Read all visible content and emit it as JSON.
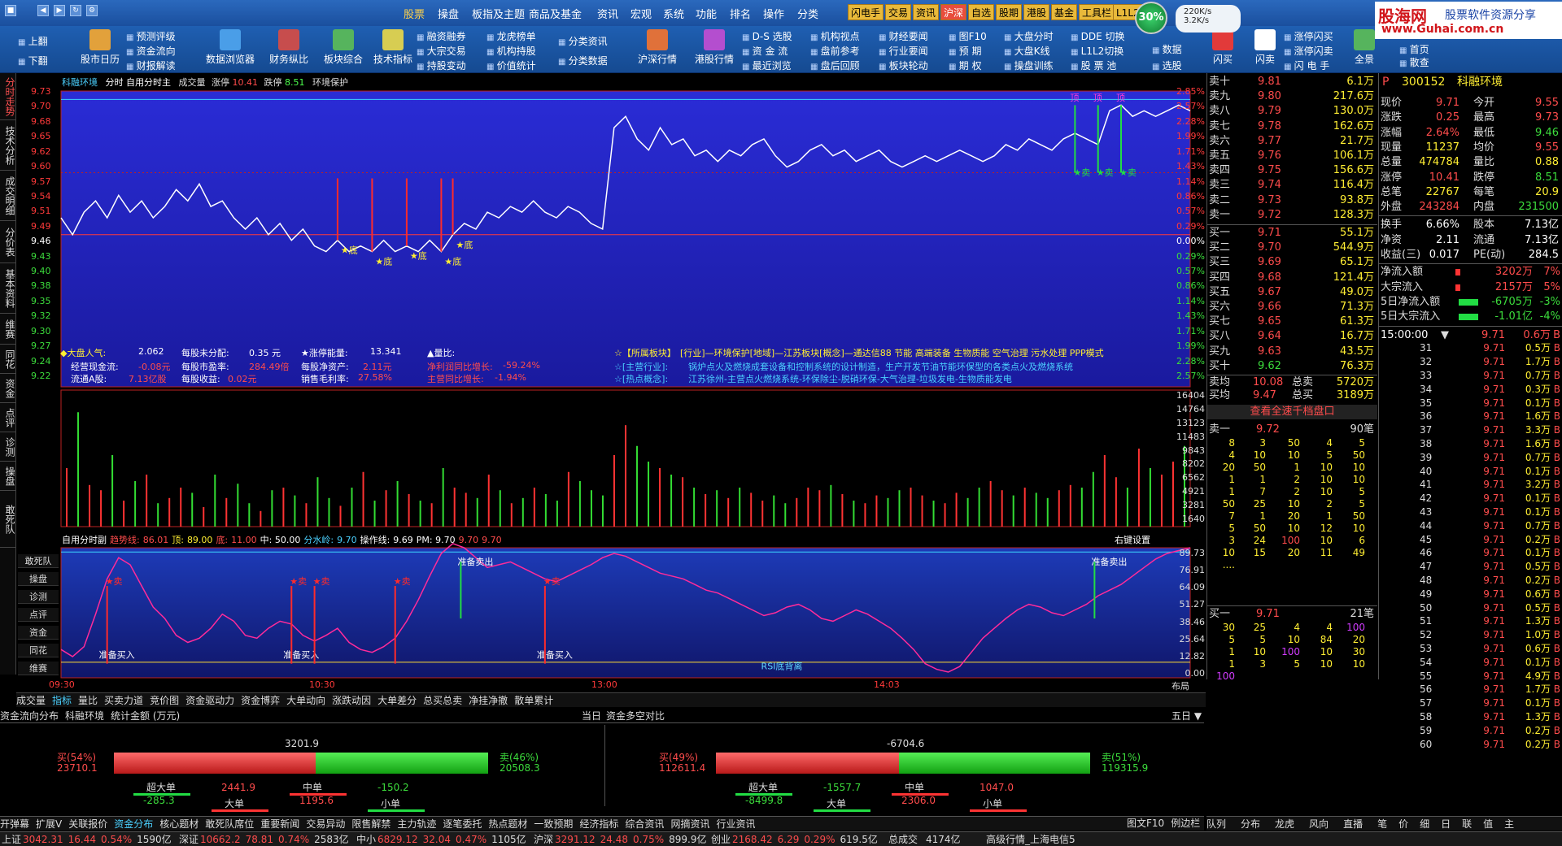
{
  "titlebar": {
    "menu": [
      "股票",
      "操盘",
      "板指及主题",
      "商品及基金",
      "资讯",
      "宏观",
      "系统",
      "功能",
      "排名",
      "操作",
      "分类"
    ],
    "hot": [
      "闪电手",
      "交易",
      "资讯",
      "沪深",
      "自选",
      "股期",
      "港股",
      "基金",
      "工具栏",
      "L1L2"
    ],
    "cpu": "30%",
    "net_up": "220K/s",
    "net_down": "3.2K/s",
    "brand": "股海网",
    "brand_sub": "股票软件资源分享",
    "brand_url": "www.Guhai.com.cn"
  },
  "toolbar": {
    "left_btns": [
      "上翻",
      "下翻"
    ],
    "big_btns": [
      "股市日历",
      "数据浏览器",
      "财务纵比",
      "板块综合",
      "技术指标",
      "沪深行情",
      "港股行情"
    ],
    "small_btns": [
      "预测评级",
      "资金流向",
      "财报解读",
      "融资融券",
      "大宗交易",
      "持股变动",
      "龙虎榜单",
      "机构持股",
      "价值统计",
      "分类资讯",
      "分类数据",
      "D-S 选股",
      "资 金 流",
      "最近浏览",
      "机构视点",
      "盘前参考",
      "盘后回顾",
      "财经要闻",
      "行业要闻",
      "板块轮动",
      "图F10",
      "预 期",
      "期 权",
      "大盘分时",
      "大盘K线",
      "操盘训练",
      "DDE 切换",
      "L1L2切换",
      "股 票 池",
      "数据",
      "选股",
      "涨停闪买",
      "涨停闪卖",
      "闪 电 手"
    ],
    "right_btns": [
      "闪买",
      "闪卖",
      "全景",
      "首页",
      "散查"
    ]
  },
  "lefttabs": [
    "分时走势",
    "技术分析",
    "成交明细",
    "分价表",
    "基本资料",
    "维赛",
    "同花",
    "资金",
    "点评",
    "诊测",
    "操盘",
    "敢死队"
  ],
  "chart": {
    "header": {
      "name": "科融环境",
      "mode": "分时 自用分时主",
      "vol": "成交量",
      "zt_label": "涨停",
      "zt": "10.41",
      "dt_label": "跌停",
      "dt": "8.51",
      "tag": "环境保护"
    },
    "price_axis_left": [
      "9.73",
      "9.70",
      "9.68",
      "9.65",
      "9.62",
      "9.60",
      "9.57",
      "9.54",
      "9.51",
      "9.49",
      "9.46",
      "9.43",
      "9.40",
      "9.38",
      "9.35",
      "9.32",
      "9.30",
      "9.27",
      "9.24",
      "9.22"
    ],
    "price_axis_right": [
      "2.85%",
      "2.57%",
      "2.28%",
      "1.99%",
      "1.71%",
      "1.43%",
      "1.14%",
      "0.86%",
      "0.57%",
      "0.29%",
      "0.00%",
      "0.29%",
      "0.57%",
      "0.86%",
      "1.14%",
      "1.43%",
      "1.71%",
      "1.99%",
      "2.28%",
      "2.57%"
    ],
    "price_line": [
      9.52,
      9.49,
      9.53,
      9.55,
      9.52,
      9.56,
      9.53,
      9.55,
      9.52,
      9.54,
      9.57,
      9.55,
      9.58,
      9.54,
      9.55,
      9.52,
      9.5,
      9.52,
      9.49,
      9.51,
      9.48,
      9.5,
      9.47,
      9.46,
      9.48,
      9.46,
      9.47,
      9.46,
      9.48,
      9.46,
      9.47,
      9.46,
      9.48,
      9.46,
      9.49,
      9.51,
      9.5,
      9.53,
      9.52,
      9.54,
      9.53,
      9.55,
      9.53,
      9.52,
      9.54,
      9.53,
      9.51,
      9.5,
      9.68,
      9.7,
      9.66,
      9.64,
      9.68,
      9.65,
      9.66,
      9.63,
      9.64,
      9.62,
      9.64,
      9.63,
      9.65,
      9.66,
      9.63,
      9.61,
      9.62,
      9.64,
      9.65,
      9.63,
      9.64,
      9.62,
      9.63,
      9.64,
      9.62,
      9.61,
      9.62,
      9.63,
      9.62,
      9.63,
      9.64,
      9.63,
      9.62,
      9.63,
      9.65,
      9.64,
      9.66,
      9.65,
      9.64,
      9.66,
      9.67,
      9.66,
      9.65,
      9.71,
      9.72,
      9.7,
      9.71,
      9.7,
      9.71,
      9.72,
      9.71
    ],
    "signal_labels": {
      "bottom": "底",
      "sell": "卖",
      "top": "顶",
      "ready_buy": "准备买入",
      "ready_sell": "准备卖出",
      "rsi": "RSI底背离"
    },
    "info": {
      "dpqy_label": "◆大盘人气:",
      "dpqy": "2.062",
      "mgwfp_label": "每股未分配:",
      "mgwfp": "0.35 元",
      "ztnl_label": "★涨停能量:",
      "ztnl": "13.341",
      "lb_label": "▲量比:",
      "jyxjl_label": "经营现金流:",
      "jyxjl": "-0.08元",
      "mgsyl_label": "每股市盈率:",
      "mgsyl": "284.49倍",
      "mgjzc_label": "每股净资产:",
      "mgjzc": "2.11元",
      "jlrtb_label": "净利润同比增长:",
      "jlrtb": "-59.24%",
      "ltag_label": "流通A股:",
      "ltag": "7.13亿股",
      "mgsy_label": "每股收益:",
      "mgsy": "0.02元",
      "xsmll_label": "销售毛利率:",
      "xsmll": "27.58%",
      "zytb_label": "主营同比增长:",
      "zytb": "-1.94%",
      "bk_title": "☆【所属板块】",
      "bk": "[行业]—环境保护[地域]—江苏板块[概念]—通达信88 节能 高端装备 生物质能 空气治理 污水处理 PPP模式",
      "zy_title": "☆[主营行业]:",
      "zy": "锅炉点火及燃烧成套设备和控制系统的设计制造，生产开发节油节能环保型的各类点火及燃烧系统",
      "rd_title": "☆[热点概念]:",
      "rd": "江苏徐州-主营点火燃烧系统-环保除尘-脱硝环保-大气治理-垃圾发电-生物质能发电"
    },
    "vol_axis": [
      "16404",
      "14764",
      "13123",
      "11483",
      "9843",
      "8202",
      "6562",
      "4921",
      "3281",
      "1640"
    ],
    "volumes": [
      45,
      88,
      32,
      28,
      55,
      20,
      35,
      40,
      18,
      22,
      30,
      26,
      15,
      40,
      22,
      33,
      18,
      12,
      28,
      30,
      24,
      18,
      38,
      22,
      16,
      30,
      42,
      20,
      28,
      35,
      25,
      20,
      18,
      45,
      30,
      26,
      22,
      40,
      28,
      18,
      22,
      30,
      25,
      20,
      42,
      35,
      28,
      24,
      55,
      78,
      62,
      50,
      45,
      40,
      38,
      30,
      25,
      28,
      22,
      30,
      26,
      20,
      24,
      18,
      22,
      30,
      28,
      32,
      25,
      20,
      18,
      24,
      22,
      28,
      30,
      24,
      20,
      18,
      26,
      22,
      30,
      35,
      28,
      24,
      30,
      26,
      22,
      28,
      32,
      30,
      42,
      55,
      38,
      30,
      60,
      45,
      40,
      50,
      62
    ],
    "indicator": {
      "name": "自用分时副",
      "qsx_label": "趋势线:",
      "qsx": "86.01",
      "ding_label": "顶:",
      "ding": "89.00",
      "di_label": "底:",
      "di": "11.00",
      "zhong": "中: 50.00",
      "fsl_label": "分水岭:",
      "fsl": "9.70",
      "czx_label": "操作线:",
      "czx": "9.69",
      "pm": "PM: 9.70",
      "v1": "9.70",
      "v2": "9.70",
      "settings": "右键设置"
    },
    "ind_axis": [
      "89.73",
      "76.91",
      "64.09",
      "51.27",
      "38.46",
      "25.64",
      "12.82",
      "0.00"
    ],
    "ind_line": [
      20,
      15,
      22,
      45,
      70,
      85,
      80,
      65,
      50,
      42,
      30,
      25,
      28,
      35,
      45,
      40,
      30,
      28,
      35,
      40,
      38,
      30,
      26,
      30,
      35,
      25,
      20,
      18,
      22,
      28,
      40,
      55,
      72,
      88,
      95,
      92,
      85,
      78,
      80,
      82,
      78,
      74,
      70,
      68,
      72,
      76,
      80,
      85,
      88,
      86,
      82,
      78,
      74,
      72,
      70,
      66,
      62,
      60,
      56,
      52,
      48,
      44,
      46,
      50,
      52,
      48,
      42,
      40,
      44,
      48,
      45,
      40,
      35,
      28,
      20,
      10,
      6,
      4,
      8,
      18,
      28,
      35,
      42,
      48,
      52,
      50,
      46,
      44,
      48,
      52,
      58,
      62,
      66,
      72,
      78,
      84,
      88,
      90,
      92
    ],
    "ind_labels": [
      "敢死队",
      "操盘",
      "诊测",
      "点评",
      "资金",
      "同花",
      "维赛"
    ],
    "time_axis": [
      "09:30",
      "10:30",
      "13:00",
      "14:03"
    ],
    "tabs": [
      "成交量",
      "指标",
      "量比",
      "买卖力道",
      "竞价图",
      "资金驱动力",
      "资金博弈",
      "大单动向",
      "涨跌动因",
      "大单差分",
      "总买总卖",
      "净挂净撤",
      "散单累计"
    ],
    "right_tab": "布局"
  },
  "orderbook": {
    "sell": [
      [
        "卖十",
        "9.81",
        "6.1万"
      ],
      [
        "卖九",
        "9.80",
        "217.6万"
      ],
      [
        "卖八",
        "9.79",
        "130.0万"
      ],
      [
        "卖七",
        "9.78",
        "162.6万"
      ],
      [
        "卖六",
        "9.77",
        "21.7万"
      ],
      [
        "卖五",
        "9.76",
        "106.1万"
      ],
      [
        "卖四",
        "9.75",
        "156.6万"
      ],
      [
        "卖三",
        "9.74",
        "116.4万"
      ],
      [
        "卖二",
        "9.73",
        "93.8万"
      ],
      [
        "卖一",
        "9.72",
        "128.3万"
      ]
    ],
    "buy": [
      [
        "买一",
        "9.71",
        "55.1万"
      ],
      [
        "买二",
        "9.70",
        "544.9万"
      ],
      [
        "买三",
        "9.69",
        "65.1万"
      ],
      [
        "买四",
        "9.68",
        "121.4万"
      ],
      [
        "买五",
        "9.67",
        "49.0万"
      ],
      [
        "买六",
        "9.66",
        "71.3万"
      ],
      [
        "买七",
        "9.65",
        "61.3万"
      ],
      [
        "买八",
        "9.64",
        "16.7万"
      ],
      [
        "买九",
        "9.63",
        "43.5万"
      ],
      [
        "买十",
        "9.62",
        "76.3万"
      ]
    ],
    "avg": [
      [
        "卖均",
        "10.08",
        "总卖",
        "5720万"
      ],
      [
        "买均",
        "9.47",
        "总买",
        "3189万"
      ]
    ],
    "thousand_link": "查看全速千档盘口",
    "sell1_title": "卖一",
    "sell1_price": "9.72",
    "sell1_count": "90笔",
    "sell1_grid": [
      [
        "8",
        "3",
        "50",
        "4",
        "5"
      ],
      [
        "4",
        "10",
        "10",
        "5",
        "50"
      ],
      [
        "20",
        "50",
        "1",
        "10",
        "10"
      ],
      [
        "1",
        "1",
        "2",
        "10",
        "10"
      ],
      [
        "1",
        "7",
        "2",
        "10",
        "5"
      ],
      [
        "50",
        "25",
        "10",
        "2",
        "5"
      ],
      [
        "7",
        "1",
        "20",
        "1",
        "50"
      ],
      [
        "5",
        "50",
        "10",
        "12",
        "10"
      ],
      [
        "3",
        "24",
        "100",
        "10",
        "6"
      ],
      [
        "10",
        "15",
        "20",
        "11",
        "49"
      ],
      [
        "....",
        "",
        "",
        "",
        ""
      ]
    ],
    "buy1_title": "买一",
    "buy1_price": "9.71",
    "buy1_count": "21笔",
    "buy1_grid": [
      [
        "30",
        "25",
        "4",
        "4",
        "100"
      ],
      [
        "5",
        "5",
        "10",
        "84",
        "20"
      ],
      [
        "1",
        "10",
        "100",
        "10",
        "30"
      ],
      [
        "1",
        "3",
        "5",
        "10",
        "10"
      ],
      [
        "100",
        "",
        "",
        "",
        ""
      ]
    ]
  },
  "quote": {
    "code": "300152",
    "name": "科融环境",
    "rows": [
      [
        "现价",
        "9.71",
        "今开",
        "9.55"
      ],
      [
        "涨跌",
        "0.25",
        "最高",
        "9.73"
      ],
      [
        "涨幅",
        "2.64%",
        "最低",
        "9.46"
      ],
      [
        "现量",
        "11237",
        "均价",
        "9.55"
      ],
      [
        "总量",
        "474784",
        "量比",
        "0.88"
      ],
      [
        "涨停",
        "10.41",
        "跌停",
        "8.51"
      ],
      [
        "总笔",
        "22767",
        "每笔",
        "20.9"
      ],
      [
        "外盘",
        "243284",
        "内盘",
        "231500"
      ]
    ],
    "rows2": [
      [
        "换手",
        "6.66%",
        "股本",
        "7.13亿"
      ],
      [
        "净资",
        "2.11",
        "流通",
        "7.13亿"
      ],
      [
        "收益(三)",
        "0.017",
        "PE(动)",
        "284.5"
      ]
    ],
    "flows": [
      [
        "净流入额",
        "3202万",
        "7%"
      ],
      [
        "大宗流入",
        "2157万",
        "5%"
      ],
      [
        "5日净流入额",
        "-6705万",
        "-3%"
      ],
      [
        "5日大宗流入",
        "-1.01亿",
        "-4%"
      ]
    ],
    "ticks_head": "15:00:00",
    "ticks": [
      [
        "9.71",
        "0.6万",
        "B"
      ],
      [
        "9.71",
        "0.5万",
        "B"
      ],
      [
        "9.71",
        "1.7万",
        "B"
      ],
      [
        "9.71",
        "0.7万",
        "B"
      ],
      [
        "9.71",
        "0.3万",
        "B"
      ],
      [
        "9.71",
        "0.1万",
        "B"
      ],
      [
        "9.71",
        "1.6万",
        "B"
      ],
      [
        "9.71",
        "3.3万",
        "B"
      ],
      [
        "9.71",
        "1.6万",
        "B"
      ],
      [
        "9.71",
        "0.7万",
        "B"
      ],
      [
        "9.71",
        "0.1万",
        "B"
      ],
      [
        "9.71",
        "3.2万",
        "B"
      ],
      [
        "9.71",
        "0.1万",
        "B"
      ],
      [
        "9.71",
        "0.1万",
        "B"
      ],
      [
        "9.71",
        "0.7万",
        "B"
      ],
      [
        "9.71",
        "0.2万",
        "B"
      ],
      [
        "9.71",
        "0.1万",
        "B"
      ],
      [
        "9.71",
        "0.5万",
        "B"
      ],
      [
        "9.71",
        "0.2万",
        "B"
      ],
      [
        "9.71",
        "0.6万",
        "B"
      ],
      [
        "9.71",
        "0.5万",
        "B"
      ],
      [
        "9.71",
        "1.3万",
        "B"
      ],
      [
        "9.71",
        "1.0万",
        "B"
      ],
      [
        "9.71",
        "0.6万",
        "B"
      ],
      [
        "9.71",
        "0.1万",
        "B"
      ],
      [
        "9.71",
        "4.9万",
        "B"
      ],
      [
        "9.71",
        "1.7万",
        "B"
      ],
      [
        "9.71",
        "0.1万",
        "B"
      ],
      [
        "9.71",
        "1.3万",
        "B"
      ],
      [
        "9.71",
        "0.2万",
        "B"
      ]
    ],
    "tick_idx": [
      "31",
      "32",
      "33",
      "34",
      "35",
      "36",
      "37",
      "38",
      "39",
      "40",
      "41",
      "42",
      "43",
      "44",
      "45",
      "46",
      "47",
      "48",
      "49",
      "50",
      "51",
      "52",
      "53",
      "54",
      "55",
      "56",
      "57",
      "58",
      "59",
      "60"
    ],
    "bottom_tabs": [
      "队列",
      "分布",
      "龙虎",
      "风向",
      "直播",
      "笔",
      "价",
      "细",
      "日",
      "联",
      "值",
      "主"
    ]
  },
  "bottom": {
    "header_left": "资金流向分布",
    "header_name": "科融环境",
    "header_unit": "统计金额 (万元)",
    "today": "当日",
    "dk_title": "资金多空对比",
    "five_day": "五日 ▼",
    "left": {
      "net": "3201.9",
      "buy_pct": "买(54%)",
      "buy": "23710.1",
      "sell_pct": "卖(46%)",
      "sell": "20508.3",
      "buy_frac": 0.54,
      "groups": [
        [
          "超大单",
          "-285.3"
        ],
        [
          "大单",
          "2441.9"
        ],
        [
          "中单",
          "1195.6"
        ],
        [
          "小单",
          "-150.2"
        ]
      ]
    },
    "right": {
      "net": "-6704.6",
      "buy_pct": "买(49%)",
      "buy": "112611.4",
      "sell_pct": "卖(51%)",
      "sell": "119315.9",
      "buy_frac": 0.49,
      "groups": [
        [
          "超大单",
          "-8499.8"
        ],
        [
          "大单",
          "-1557.7"
        ],
        [
          "中单",
          "2306.0"
        ],
        [
          "小单",
          "1047.0"
        ]
      ]
    },
    "tabs": [
      "开弹幕",
      "扩展V",
      "关联报价",
      "资金分布",
      "核心题材",
      "敢死队席位",
      "重要新闻",
      "交易异动",
      "限售解禁",
      "主力轨迹",
      "逐笔委托",
      "热点题材",
      "一致预期",
      "经济指标",
      "综合资讯",
      "网摘资讯",
      "行业资讯"
    ],
    "tabs_right": [
      "图文F10",
      "例边栏<"
    ]
  },
  "status": [
    [
      "上证",
      "3042.31",
      "16.44",
      "0.54%",
      "1590亿"
    ],
    [
      "深证",
      "10662.2",
      "78.81",
      "0.74%",
      "2583亿"
    ],
    [
      "中小",
      "6829.12",
      "32.04",
      "0.47%",
      "1105亿"
    ],
    [
      "沪深",
      "3291.12",
      "24.48",
      "0.75%",
      "899.9亿"
    ],
    [
      "创业",
      "2168.42",
      "6.29",
      "0.29%",
      "619.5亿"
    ]
  ],
  "status_total": "总成交",
  "status_total_val": "4174亿",
  "status_server": "高级行情_上海电信5"
}
